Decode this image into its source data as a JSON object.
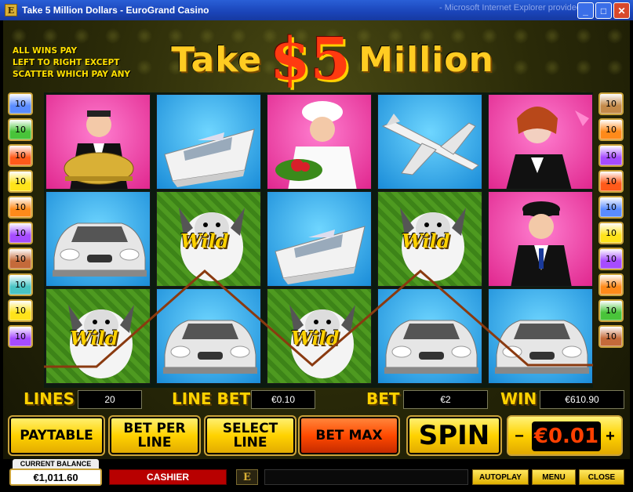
{
  "window": {
    "title": "Take 5 Million Dollars - EuroGrand Casino",
    "app_icon": "E",
    "background_title": "- Microsoft Internet Explorer provided by...",
    "controls": [
      "_",
      "□",
      "✕"
    ]
  },
  "game": {
    "logo": {
      "word1": "Take",
      "amount": "$5",
      "word2": "Million"
    },
    "rules": [
      "ALL WINS PAY",
      "LEFT TO RIGHT EXCEPT",
      "SCATTER WHICH PAY ANY"
    ],
    "left_lines": [
      {
        "label": "10",
        "color": "#5a8cff"
      },
      {
        "label": "10",
        "color": "#49c43a"
      },
      {
        "label": "10",
        "color": "#ff5a1a"
      },
      {
        "label": "10",
        "color": "#ffe31a"
      },
      {
        "label": "10",
        "color": "#ff8a1a"
      },
      {
        "label": "10",
        "color": "#a64cff"
      },
      {
        "label": "10",
        "color": "#c46a3a"
      },
      {
        "label": "10",
        "color": "#49c4c4"
      },
      {
        "label": "10",
        "color": "#ffe31a"
      },
      {
        "label": "10",
        "color": "#a64cff"
      }
    ],
    "right_lines": [
      {
        "label": "10",
        "color": "#c48a4a"
      },
      {
        "label": "10",
        "color": "#ff8a1a"
      },
      {
        "label": "10",
        "color": "#a64cff"
      },
      {
        "label": "10",
        "color": "#ff5a1a"
      },
      {
        "label": "10",
        "color": "#5a8cff"
      },
      {
        "label": "10",
        "color": "#ffe31a"
      },
      {
        "label": "10",
        "color": "#a64cff"
      },
      {
        "label": "10",
        "color": "#ff8a1a"
      },
      {
        "label": "10",
        "color": "#49c43a"
      },
      {
        "label": "10",
        "color": "#c46a3a"
      }
    ],
    "reels": [
      [
        "butler",
        "sports-car",
        "wild-dog"
      ],
      [
        "yacht",
        "wild-dog",
        "sports-car"
      ],
      [
        "chef",
        "yacht",
        "wild-dog"
      ],
      [
        "jet",
        "wild-dog",
        "sports-car"
      ],
      [
        "maid",
        "chauffeur",
        "sports-car"
      ]
    ],
    "wild_label": "Wild",
    "payline_color": "#8a3a10",
    "info": {
      "lines_label": "LINES",
      "lines_value": "20",
      "line_bet_label": "LINE BET",
      "line_bet_value": "€0.10",
      "bet_label": "BET",
      "bet_value": "€2",
      "win_label": "WIN",
      "win_value": "€610.90"
    },
    "buttons": {
      "paytable": "PAYTABLE",
      "bet_per_line": "BET PER LINE",
      "select_line": "SELECT LINE",
      "bet_max": "BET MAX",
      "spin": "SPIN",
      "minus": "−",
      "plus": "+",
      "coin_value": "€0.01"
    },
    "bottom": {
      "current_balance_label": "CURRENT BALANCE",
      "balance": "€1,011.60",
      "cashier": "CASHIER",
      "logo_icon": "E",
      "autoplay": "AUTOPLAY",
      "menu": "MENU",
      "close": "CLOSE"
    }
  }
}
